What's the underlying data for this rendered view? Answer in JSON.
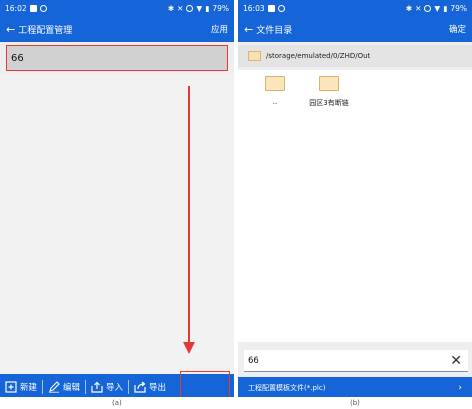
{
  "left": {
    "status": {
      "time": "16:02",
      "battery": "79%"
    },
    "appbar": {
      "title": "工程配置管理",
      "action": "应用"
    },
    "selected_item": "66",
    "bottom": {
      "new": "新建",
      "edit": "编辑",
      "import": "导入",
      "export": "导出"
    },
    "caption": "(a)"
  },
  "right": {
    "status": {
      "time": "16:03",
      "battery": "79%"
    },
    "appbar": {
      "title": "文件目录",
      "action": "确定"
    },
    "path": "/storage/emulated/0/ZHD/Out",
    "files": [
      {
        "name": ".."
      },
      {
        "name": "园区3有断链"
      }
    ],
    "filename": "66",
    "filetype": "工程配置模板文件(*.plc)",
    "caption": "(b)"
  },
  "colors": {
    "primary": "#1565d8",
    "highlight": "#e53935"
  }
}
